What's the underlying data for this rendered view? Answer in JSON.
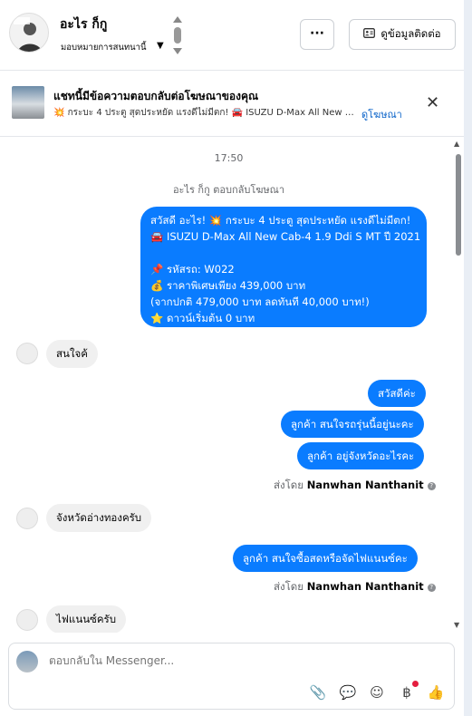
{
  "header": {
    "name": "อะไร ก็กู",
    "subtitle": "มอบหมายการสนทนานี้",
    "more_label": "···",
    "contact_label": "ดูข้อมูลติดต่อ"
  },
  "ad_banner": {
    "title": "แชทนี้มีข้อความตอบกลับต่อโฆษณาของคุณ",
    "text": "💥 กระบะ 4 ประตู สุดประหยัด แรงดีไม่มีตก! 🚘 ISUZU D-Max All New C...",
    "link": "ดูโฆษณา",
    "close": "✕"
  },
  "chat": {
    "time": "17:50",
    "replied_note": "อะไร ก็กู ตอบกลับโฆษณา",
    "ad_message_lines": [
      "สวัสดี อะไร! 💥 กระบะ 4 ประตู สุดประหยัด แรงดีไม่มีตก!",
      "🚘 ISUZU D-Max All New Cab-4 1.9 Ddi S MT ปี 2021",
      "",
      "📌 รหัสรถ: W022",
      "💰 ราคาพิเศษเพียง 439,000 บาท",
      "(จากปกติ 479,000 บาท ลดทันที 40,000 บาท!)",
      "⭐ ดาวน์เริ่มต้น 0 บาท"
    ],
    "msg_in_1": "สนใจค้",
    "msg_out_1": "สวัสดีค่ะ",
    "msg_out_2": "ลูกค้า  สนใจรถรุ่นนี้อยู่นะคะ",
    "msg_out_3": "ลูกค้า  อยู่จังหวัดอะไรคะ",
    "sent_by_prefix": "ส่งโดย",
    "sent_by_name": "Nanwhan Nanthanit",
    "msg_in_2": "จังหวัดอ่างทองครับ",
    "msg_out_4": "ลูกค้า  สนใจซื้อสดหรือจัดไฟแนนซ์คะ",
    "msg_in_3": "ไฟแนนซ์ครับ"
  },
  "composer": {
    "placeholder": "ตอบกลับใน Messenger..."
  },
  "icons": {
    "attach": "📎",
    "chat_bubble": "💬",
    "emoji": "☺",
    "payment": "฿",
    "like": "👍"
  },
  "colors": {
    "outgoing_bubble": "#0a7cff",
    "incoming_bubble": "#f0f0f0",
    "link": "#0a63c9"
  }
}
